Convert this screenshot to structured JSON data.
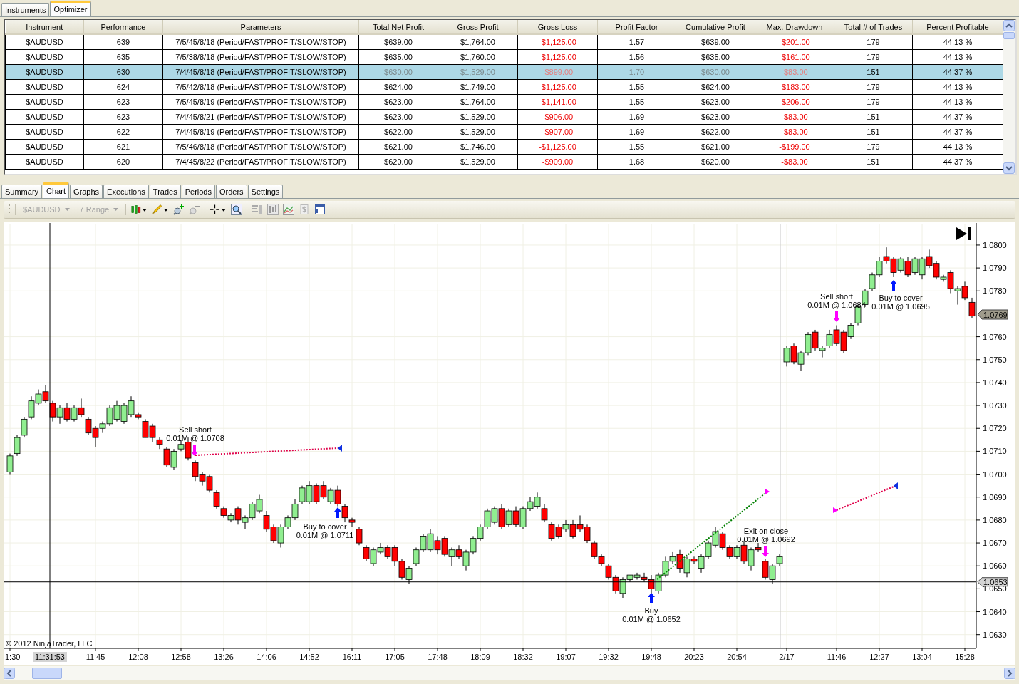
{
  "top_tabs": [
    {
      "label": "Instruments",
      "selected": false
    },
    {
      "label": "Optimizer",
      "selected": true
    }
  ],
  "results": {
    "columns": [
      {
        "label": "Instrument",
        "kind": "plain"
      },
      {
        "label": "Performance",
        "kind": "plain"
      },
      {
        "label": "Parameters",
        "kind": "plain"
      },
      {
        "label": "Total Net Profit",
        "kind": "dim"
      },
      {
        "label": "Gross Profit",
        "kind": "dim"
      },
      {
        "label": "Gross Loss",
        "kind": "loss"
      },
      {
        "label": "Profit Factor",
        "kind": "dim"
      },
      {
        "label": "Cumulative Profit",
        "kind": "dim"
      },
      {
        "label": "Max. Drawdown",
        "kind": "loss"
      },
      {
        "label": "Total # of Trades",
        "kind": "plain"
      },
      {
        "label": "Percent Profitable",
        "kind": "plain"
      }
    ],
    "rows": [
      {
        "selected": false,
        "cells": [
          "$AUDUSD",
          "639",
          "7/5/45/8/18 (Period/FAST/PROFIT/SLOW/STOP)",
          "$639.00",
          "$1,764.00",
          "-$1,125.00",
          "1.57",
          "$639.00",
          "-$201.00",
          "179",
          "44.13 %"
        ]
      },
      {
        "selected": false,
        "cells": [
          "$AUDUSD",
          "635",
          "7/5/38/8/18 (Period/FAST/PROFIT/SLOW/STOP)",
          "$635.00",
          "$1,760.00",
          "-$1,125.00",
          "1.56",
          "$635.00",
          "-$161.00",
          "179",
          "44.13 %"
        ]
      },
      {
        "selected": true,
        "cells": [
          "$AUDUSD",
          "630",
          "7/4/45/8/18 (Period/FAST/PROFIT/SLOW/STOP)",
          "$630.00",
          "$1,529.00",
          "-$899.00",
          "1.70",
          "$630.00",
          "-$83.00",
          "151",
          "44.37 %"
        ]
      },
      {
        "selected": false,
        "cells": [
          "$AUDUSD",
          "624",
          "7/5/42/8/18 (Period/FAST/PROFIT/SLOW/STOP)",
          "$624.00",
          "$1,749.00",
          "-$1,125.00",
          "1.55",
          "$624.00",
          "-$183.00",
          "179",
          "44.13 %"
        ]
      },
      {
        "selected": false,
        "cells": [
          "$AUDUSD",
          "623",
          "7/5/45/8/19 (Period/FAST/PROFIT/SLOW/STOP)",
          "$623.00",
          "$1,764.00",
          "-$1,141.00",
          "1.55",
          "$623.00",
          "-$206.00",
          "179",
          "44.13 %"
        ]
      },
      {
        "selected": false,
        "cells": [
          "$AUDUSD",
          "623",
          "7/4/45/8/21 (Period/FAST/PROFIT/SLOW/STOP)",
          "$623.00",
          "$1,529.00",
          "-$906.00",
          "1.69",
          "$623.00",
          "-$83.00",
          "151",
          "44.37 %"
        ]
      },
      {
        "selected": false,
        "cells": [
          "$AUDUSD",
          "622",
          "7/4/45/8/19 (Period/FAST/PROFIT/SLOW/STOP)",
          "$622.00",
          "$1,529.00",
          "-$907.00",
          "1.69",
          "$622.00",
          "-$83.00",
          "151",
          "44.37 %"
        ]
      },
      {
        "selected": false,
        "cells": [
          "$AUDUSD",
          "621",
          "7/5/46/8/18 (Period/FAST/PROFIT/SLOW/STOP)",
          "$621.00",
          "$1,746.00",
          "-$1,125.00",
          "1.55",
          "$621.00",
          "-$199.00",
          "179",
          "44.13 %"
        ]
      },
      {
        "selected": false,
        "cells": [
          "$AUDUSD",
          "620",
          "7/4/45/8/22 (Period/FAST/PROFIT/SLOW/STOP)",
          "$620.00",
          "$1,529.00",
          "-$909.00",
          "1.68",
          "$620.00",
          "-$83.00",
          "151",
          "44.37 %"
        ]
      }
    ]
  },
  "bottom_tabs": [
    {
      "label": "Summary",
      "selected": false
    },
    {
      "label": "Chart",
      "selected": true
    },
    {
      "label": "Graphs",
      "selected": false
    },
    {
      "label": "Executions",
      "selected": false
    },
    {
      "label": "Trades",
      "selected": false
    },
    {
      "label": "Periods",
      "selected": false
    },
    {
      "label": "Orders",
      "selected": false
    },
    {
      "label": "Settings",
      "selected": false
    }
  ],
  "toolbar": {
    "instrument": {
      "value": "$AUDUSD",
      "disabled": true
    },
    "period": {
      "value": "7 Range",
      "disabled": true
    }
  },
  "chart": {
    "chart_data": {
      "type": "candlestick",
      "categories": [
        "1:30",
        null,
        null,
        null,
        null,
        null,
        null,
        null,
        null,
        null,
        null,
        null,
        "11:45",
        null,
        null,
        null,
        null,
        null,
        "12:08",
        null,
        null,
        null,
        null,
        null,
        "12:58",
        null,
        null,
        null,
        null,
        null,
        "13:26",
        null,
        null,
        null,
        null,
        null,
        "14:06",
        null,
        null,
        null,
        null,
        null,
        "14:52",
        null,
        null,
        null,
        null,
        null,
        "16:11",
        null,
        null,
        null,
        null,
        null,
        "17:05",
        null,
        null,
        null,
        null,
        null,
        "17:48",
        null,
        null,
        null,
        null,
        null,
        "18:09",
        null,
        null,
        null,
        null,
        null,
        "18:32",
        null,
        null,
        null,
        null,
        null,
        "19:07",
        null,
        null,
        null,
        null,
        null,
        "19:32",
        null,
        null,
        null,
        null,
        null,
        "19:48",
        null,
        null,
        null,
        null,
        null,
        "20:23",
        null,
        null,
        null,
        null,
        null,
        "20:54",
        null,
        null,
        null,
        null,
        null,
        null,
        "2/17",
        null,
        null,
        null,
        null,
        null,
        null,
        "11:46",
        null,
        null,
        null,
        null,
        null,
        "12:27",
        null,
        null,
        null,
        null,
        null,
        "13:04",
        null,
        null,
        null,
        null,
        null,
        "15:28",
        null
      ],
      "ohlc": [
        [
          1.0701,
          1.0709,
          1.07,
          1.0708
        ],
        [
          1.0709,
          1.0717,
          1.0708,
          1.0716
        ],
        [
          1.0717,
          1.0725,
          1.0716,
          1.0724
        ],
        [
          1.0725,
          1.0734,
          1.0724,
          1.0732
        ],
        [
          1.0731,
          1.0737,
          1.073,
          1.0735
        ],
        [
          1.0736,
          1.0739,
          1.0731,
          1.0732
        ],
        [
          1.0731,
          1.0732,
          1.0723,
          1.0725
        ],
        [
          1.0725,
          1.073,
          1.0722,
          1.0729
        ],
        [
          1.0729,
          1.0731,
          1.0723,
          1.0724
        ],
        [
          1.0724,
          1.073,
          1.0723,
          1.0729
        ],
        [
          1.0729,
          1.0733,
          1.0725,
          1.0726
        ],
        [
          1.0724,
          1.0725,
          1.0717,
          1.0718
        ],
        [
          1.072,
          1.0721,
          1.0712,
          1.0716
        ],
        [
          1.072,
          1.0723,
          1.0718,
          1.0722
        ],
        [
          1.0722,
          1.073,
          1.0721,
          1.0729
        ],
        [
          1.0724,
          1.0732,
          1.0723,
          1.073
        ],
        [
          1.0723,
          1.0731,
          1.0722,
          1.073
        ],
        [
          1.0726,
          1.0734,
          1.0725,
          1.0732
        ],
        [
          1.0726,
          1.0727,
          1.0724,
          1.0725
        ],
        [
          1.0723,
          1.0724,
          1.0716,
          1.0716
        ],
        [
          1.0721,
          1.0722,
          1.0714,
          1.0716
        ],
        [
          1.0715,
          1.0716,
          1.0711,
          1.0713
        ],
        [
          1.0711,
          1.0712,
          1.0703,
          1.0704
        ],
        [
          1.0703,
          1.0711,
          1.0702,
          1.071
        ],
        [
          1.0711,
          1.0715,
          1.071,
          1.0713
        ],
        [
          1.0714,
          1.0716,
          1.0706,
          1.0707
        ],
        [
          1.0705,
          1.0706,
          1.0697,
          1.0699
        ],
        [
          1.07,
          1.0701,
          1.0695,
          1.0697
        ],
        [
          1.0699,
          1.07,
          1.0692,
          1.0693
        ],
        [
          1.0692,
          1.0693,
          1.0685,
          1.0686
        ],
        [
          1.0685,
          1.0686,
          1.0681,
          1.0682
        ],
        [
          1.068,
          1.0683,
          1.0679,
          1.0682
        ],
        [
          1.0685,
          1.0686,
          1.0678,
          1.068
        ],
        [
          1.0679,
          1.0682,
          1.0676,
          1.0681
        ],
        [
          1.0681,
          1.0688,
          1.068,
          1.0687
        ],
        [
          1.0684,
          1.0691,
          1.0683,
          1.0689
        ],
        [
          1.0682,
          1.0684,
          1.0675,
          1.0676
        ],
        [
          1.0677,
          1.0678,
          1.067,
          1.0671
        ],
        [
          1.067,
          1.0678,
          1.0668,
          1.0677
        ],
        [
          1.0677,
          1.0682,
          1.0676,
          1.0681
        ],
        [
          1.0681,
          1.0689,
          1.068,
          1.0687
        ],
        [
          1.0688,
          1.0695,
          1.0687,
          1.0694
        ],
        [
          1.0688,
          1.0697,
          1.0687,
          1.0695
        ],
        [
          1.0695,
          1.0696,
          1.0687,
          1.0688
        ],
        [
          1.0695,
          1.0697,
          1.0689,
          1.069
        ],
        [
          1.0688,
          1.0694,
          1.0687,
          1.0693
        ],
        [
          1.0693,
          1.0695,
          1.0686,
          1.0687
        ],
        [
          1.0686,
          1.0687,
          1.0679,
          1.0681
        ],
        [
          1.068,
          1.0681,
          1.0677,
          1.0679
        ],
        [
          1.0676,
          1.0677,
          1.0669,
          1.067
        ],
        [
          1.0668,
          1.0669,
          1.0662,
          1.0663
        ],
        [
          1.0661,
          1.0668,
          1.066,
          1.0667
        ],
        [
          1.0666,
          1.067,
          1.0665,
          1.0668
        ],
        [
          1.0668,
          1.0669,
          1.0663,
          1.0664
        ],
        [
          1.0668,
          1.0669,
          1.066,
          1.0662
        ],
        [
          1.0662,
          1.0663,
          1.0654,
          1.0655
        ],
        [
          1.0654,
          1.066,
          1.0652,
          1.0659
        ],
        [
          1.0661,
          1.0668,
          1.066,
          1.0667
        ],
        [
          1.0667,
          1.0674,
          1.0666,
          1.0673
        ],
        [
          1.0667,
          1.0676,
          1.0666,
          1.0674
        ],
        [
          1.0671,
          1.0673,
          1.0665,
          1.0667
        ],
        [
          1.0672,
          1.0673,
          1.0664,
          1.0665
        ],
        [
          1.0664,
          1.0668,
          1.066,
          1.0667
        ],
        [
          1.0667,
          1.0669,
          1.0663,
          1.0664
        ],
        [
          1.066,
          1.0667,
          1.0658,
          1.0666
        ],
        [
          1.0666,
          1.0673,
          1.0665,
          1.0672
        ],
        [
          1.0672,
          1.0678,
          1.0671,
          1.0677
        ],
        [
          1.0677,
          1.0685,
          1.0676,
          1.0684
        ],
        [
          1.0679,
          1.0686,
          1.0678,
          1.0685
        ],
        [
          1.0685,
          1.0687,
          1.0676,
          1.0677
        ],
        [
          1.0678,
          1.0685,
          1.0677,
          1.0684
        ],
        [
          1.0684,
          1.0686,
          1.0677,
          1.0678
        ],
        [
          1.0677,
          1.0686,
          1.0676,
          1.0685
        ],
        [
          1.0685,
          1.069,
          1.0684,
          1.0688
        ],
        [
          1.0686,
          1.0692,
          1.0685,
          1.069
        ],
        [
          1.0685,
          1.0687,
          1.0679,
          1.068
        ],
        [
          1.0678,
          1.0679,
          1.0671,
          1.0672
        ],
        [
          1.0677,
          1.0678,
          1.0672,
          1.0673
        ],
        [
          1.0676,
          1.068,
          1.0675,
          1.0678
        ],
        [
          1.0678,
          1.068,
          1.0672,
          1.0673
        ],
        [
          1.0678,
          1.0682,
          1.0675,
          1.0676
        ],
        [
          1.0677,
          1.0678,
          1.067,
          1.0671
        ],
        [
          1.067,
          1.0671,
          1.0663,
          1.0664
        ],
        [
          1.0664,
          1.0665,
          1.066,
          1.0661
        ],
        [
          1.066,
          1.0661,
          1.0654,
          1.0655
        ],
        [
          1.0655,
          1.0656,
          1.0648,
          1.0649
        ],
        [
          1.0648,
          1.0655,
          1.0646,
          1.0654
        ],
        [
          1.0654,
          1.0656,
          1.0653,
          1.0656
        ],
        [
          1.0655,
          1.0657,
          1.0654,
          1.0656
        ],
        [
          1.0655,
          1.0657,
          1.0653,
          1.0654
        ],
        [
          1.0654,
          1.0656,
          1.0648,
          1.065
        ],
        [
          1.0649,
          1.0657,
          1.0648,
          1.0656
        ],
        [
          1.0656,
          1.0664,
          1.0655,
          1.0662
        ],
        [
          1.0662,
          1.0666,
          1.0661,
          1.0664
        ],
        [
          1.0665,
          1.0667,
          1.0657,
          1.0659
        ],
        [
          1.0657,
          1.0664,
          1.0655,
          1.0663
        ],
        [
          1.0663,
          1.0664,
          1.0661,
          1.0662
        ],
        [
          1.0659,
          1.0665,
          1.0657,
          1.0664
        ],
        [
          1.0664,
          1.0671,
          1.0663,
          1.067
        ],
        [
          1.0669,
          1.0677,
          1.0668,
          1.0675
        ],
        [
          1.0674,
          1.0675,
          1.0667,
          1.0668
        ],
        [
          1.0668,
          1.0669,
          1.0663,
          1.0664
        ],
        [
          1.0664,
          1.0669,
          1.0663,
          1.0668
        ],
        [
          1.0669,
          1.0671,
          1.0661,
          1.0662
        ],
        [
          1.066,
          1.0668,
          1.0658,
          1.0667
        ],
        [
          1.0668,
          1.067,
          1.0666,
          1.0667
        ],
        [
          1.0662,
          1.0663,
          1.0654,
          1.0655
        ],
        [
          1.0654,
          1.0661,
          1.0652,
          1.066
        ],
        [
          1.0661,
          1.0665,
          1.066,
          1.0664
        ],
        [
          1.0749,
          1.0756,
          1.0747,
          1.0755
        ],
        [
          1.0756,
          1.0757,
          1.0748,
          1.0749
        ],
        [
          1.0748,
          1.0754,
          1.0745,
          1.0753
        ],
        [
          1.0753,
          1.0762,
          1.0752,
          1.0761
        ],
        [
          1.0762,
          1.0763,
          1.0754,
          1.0755
        ],
        [
          1.0754,
          1.0756,
          1.0751,
          1.0755
        ],
        [
          1.0756,
          1.0763,
          1.0755,
          1.0761
        ],
        [
          1.0763,
          1.0765,
          1.0756,
          1.0757
        ],
        [
          1.0762,
          1.0763,
          1.0753,
          1.0754
        ],
        [
          1.076,
          1.0766,
          1.0759,
          1.0765
        ],
        [
          1.0766,
          1.0774,
          1.0765,
          1.0773
        ],
        [
          1.0774,
          1.0781,
          1.0773,
          1.078
        ],
        [
          1.0781,
          1.0788,
          1.078,
          1.0787
        ],
        [
          1.0787,
          1.0795,
          1.0786,
          1.0793
        ],
        [
          1.0795,
          1.0799,
          1.0792,
          1.0793
        ],
        [
          1.0794,
          1.0795,
          1.0786,
          1.0788
        ],
        [
          1.0789,
          1.0795,
          1.0788,
          1.0794
        ],
        [
          1.0793,
          1.0795,
          1.0786,
          1.0787
        ],
        [
          1.0788,
          1.0795,
          1.0787,
          1.0794
        ],
        [
          1.0787,
          1.0795,
          1.0785,
          1.0794
        ],
        [
          1.0795,
          1.0798,
          1.079,
          1.0791
        ],
        [
          1.0792,
          1.0793,
          1.0785,
          1.0786
        ],
        [
          1.0785,
          1.0787,
          1.0784,
          1.0786
        ],
        [
          1.0788,
          1.0789,
          1.0779,
          1.0781
        ],
        [
          1.078,
          1.0782,
          1.0774,
          1.0781
        ],
        [
          1.0782,
          1.0784,
          1.0776,
          1.0777
        ],
        [
          1.0775,
          1.0777,
          1.0768,
          1.0769
        ]
      ],
      "ylim": [
        1.0624,
        1.0809
      ],
      "grid": true,
      "ref_lines": [
        {
          "axis": "y",
          "value": 1.0653,
          "label": "1.0653"
        }
      ],
      "yticks": [
        {
          "value": 1.08,
          "label": "1.0800"
        },
        {
          "value": 1.079,
          "label": "1.0790"
        },
        {
          "value": 1.078,
          "label": "1.0780"
        },
        {
          "value": 1.076,
          "label": "1.0760"
        },
        {
          "value": 1.075,
          "label": "1.0750"
        },
        {
          "value": 1.074,
          "label": "1.0740"
        },
        {
          "value": 1.073,
          "label": "1.0730"
        },
        {
          "value": 1.072,
          "label": "1.0720"
        },
        {
          "value": 1.071,
          "label": "1.0710"
        },
        {
          "value": 1.07,
          "label": "1.0700"
        },
        {
          "value": 1.069,
          "label": "1.0690"
        },
        {
          "value": 1.068,
          "label": "1.0680"
        },
        {
          "value": 1.067,
          "label": "1.0670"
        },
        {
          "value": 1.066,
          "label": "1.0660"
        },
        {
          "value": 1.065,
          "label": "1.0650"
        },
        {
          "value": 1.064,
          "label": "1.0640"
        },
        {
          "value": 1.063,
          "label": "1.0630"
        }
      ]
    },
    "crosshair": {
      "time": "11:31:53"
    },
    "last_price": "1.0769",
    "copyright": "© 2012 NinjaTrader, LLC",
    "trades": [
      {
        "kind": "sell_short",
        "action": "Sell short",
        "fill": "0.01M @ 1.0708"
      },
      {
        "kind": "buy_to_cover",
        "action": "Buy to cover",
        "fill": "0.01M @ 1.0711"
      },
      {
        "kind": "buy",
        "action": "Buy",
        "fill": "0.01M @ 1.0652"
      },
      {
        "kind": "exit",
        "action": "Exit on close",
        "fill": "0.01M @ 1.0692"
      },
      {
        "kind": "sell_short",
        "action": "Sell short",
        "fill": "0.01M @ 1.0684"
      },
      {
        "kind": "buy_to_cover",
        "action": "Buy to cover",
        "fill": "0.01M @ 1.0695"
      }
    ]
  }
}
